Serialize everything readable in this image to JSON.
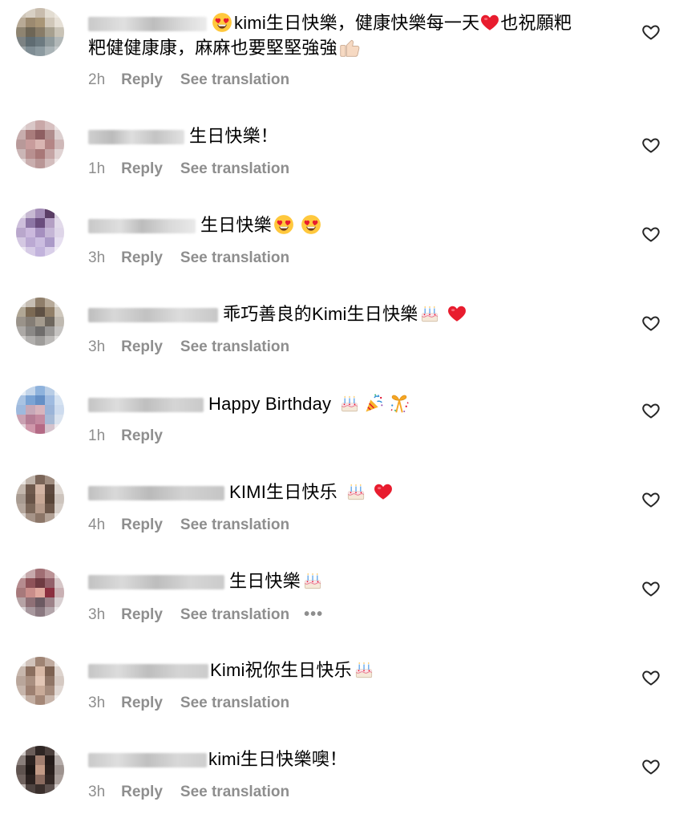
{
  "comments": [
    {
      "text_line1": "kimi生日快樂，健康快樂每一天",
      "text_line1b": "也祝願粑",
      "text_line2": "粑健健康康，麻麻也要堅堅強強",
      "time": "2h",
      "reply": "Reply",
      "translation": "See translation"
    },
    {
      "text": "生日快樂！",
      "time": "1h",
      "reply": "Reply",
      "translation": "See translation"
    },
    {
      "text": "生日快樂",
      "time": "3h",
      "reply": "Reply",
      "translation": "See translation"
    },
    {
      "text": "乖巧善良的Kimi生日快樂",
      "time": "3h",
      "reply": "Reply",
      "translation": "See translation"
    },
    {
      "text": "Happy Birthday",
      "time": "1h",
      "reply": "Reply"
    },
    {
      "text": "KIMI生日快乐",
      "time": "4h",
      "reply": "Reply",
      "translation": "See translation"
    },
    {
      "text": "生日快樂",
      "time": "3h",
      "reply": "Reply",
      "translation": "See translation",
      "more": "•••"
    },
    {
      "text": "Kimi祝你生日快乐",
      "time": "3h",
      "reply": "Reply",
      "translation": "See translation"
    },
    {
      "text": "kimi生日快樂噢！",
      "time": "3h",
      "reply": "Reply",
      "translation": "See translation"
    }
  ],
  "icons": {
    "like": "heart-outline-icon",
    "heart_emoji": "red-heart-emoji",
    "heart_eyes": "heart-eyes-emoji",
    "cake": "birthday-cake-emoji",
    "party": "party-popper-emoji",
    "ribbon": "wrapped-gift-emoji",
    "thumbs": "thumbs-up-emoji"
  },
  "colors": {
    "meta_text": "#8e8e8e",
    "heart_red": "#e0102d",
    "text": "#000000"
  }
}
